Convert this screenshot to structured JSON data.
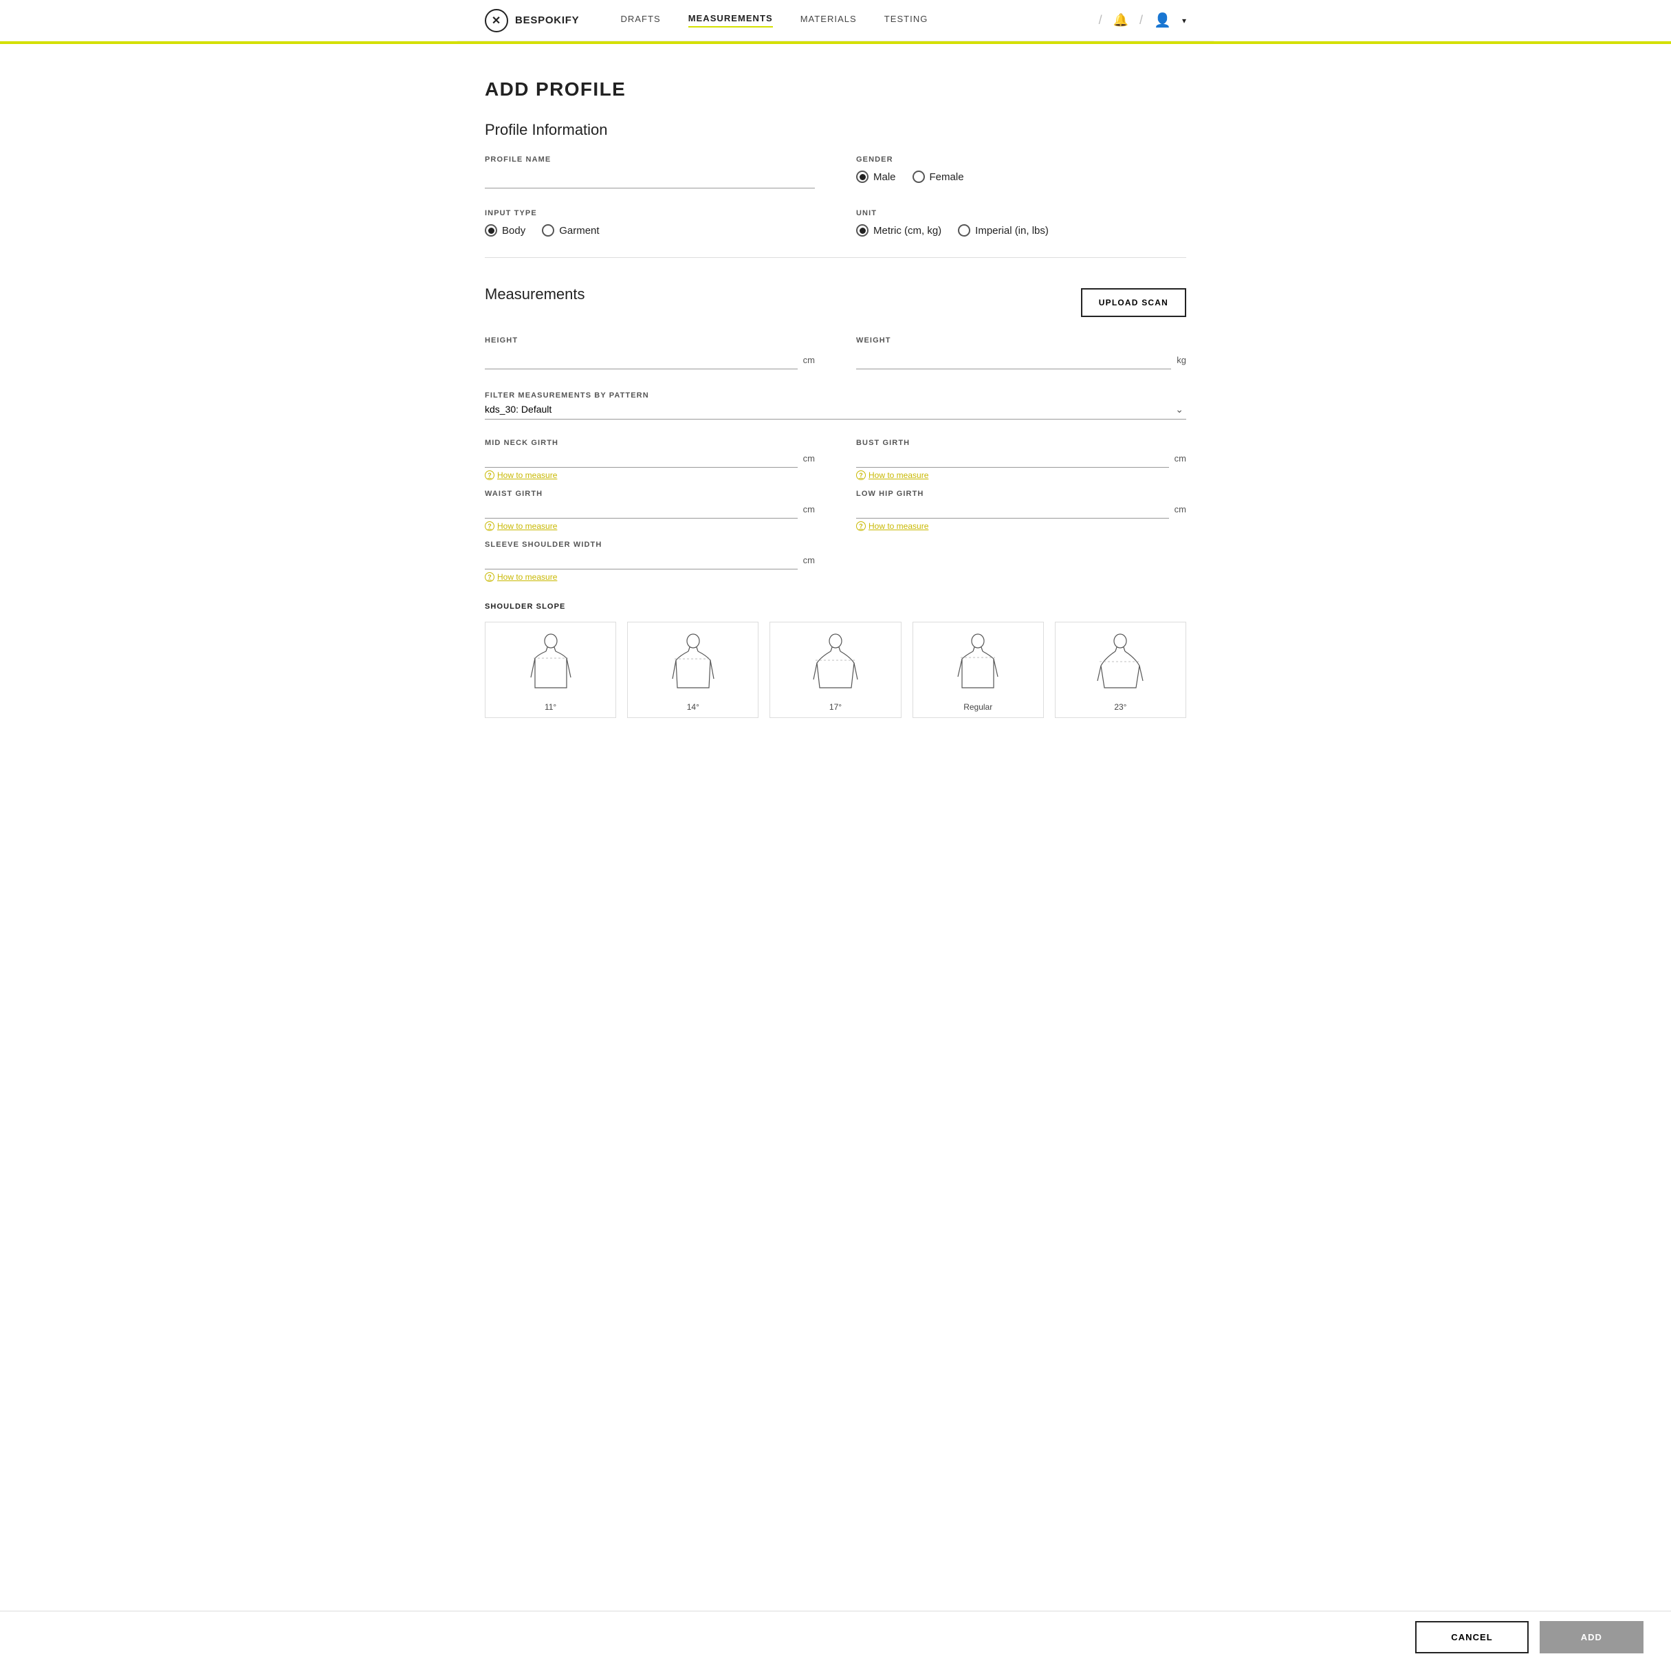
{
  "nav": {
    "logo_text": "BESPOKIFY",
    "links": [
      {
        "id": "drafts",
        "label": "DRAFTS",
        "active": false
      },
      {
        "id": "measurements",
        "label": "MEASUREMENTS",
        "active": true
      },
      {
        "id": "materials",
        "label": "MATERIALS",
        "active": false
      },
      {
        "id": "testing",
        "label": "TESTING",
        "active": false
      }
    ]
  },
  "page": {
    "title": "ADD PROFILE",
    "profile_section_title": "Profile Information",
    "profile_name_label": "PROFILE NAME",
    "profile_name_placeholder": "",
    "gender_label": "GENDER",
    "gender_options": [
      {
        "id": "male",
        "label": "Male",
        "checked": true
      },
      {
        "id": "female",
        "label": "Female",
        "checked": false
      }
    ],
    "input_type_label": "INPUT TYPE",
    "input_type_options": [
      {
        "id": "body",
        "label": "Body",
        "checked": true
      },
      {
        "id": "garment",
        "label": "Garment",
        "checked": false
      }
    ],
    "unit_label": "UNIT",
    "unit_options": [
      {
        "id": "metric",
        "label": "Metric (cm, kg)",
        "checked": true
      },
      {
        "id": "imperial",
        "label": "Imperial (in, lbs)",
        "checked": false
      }
    ],
    "measurements_title": "Measurements",
    "upload_scan_label": "UPLOAD SCAN",
    "height_label": "HEIGHT",
    "height_unit": "cm",
    "weight_label": "WEIGHT",
    "weight_unit": "kg",
    "filter_label": "FILTER MEASUREMENTS BY PATTERN",
    "filter_value": "kds_30: Default",
    "fields": [
      {
        "id": "mid_neck_girth",
        "label": "MID NECK GIRTH",
        "unit": "cm",
        "how_to": "How to measure"
      },
      {
        "id": "bust_girth",
        "label": "BUST GIRTH",
        "unit": "cm",
        "how_to": "How to measure"
      },
      {
        "id": "waist_girth",
        "label": "WAIST GIRTH",
        "unit": "cm",
        "how_to": "How to measure"
      },
      {
        "id": "low_hip_girth",
        "label": "LOW HIP GIRTH",
        "unit": "cm",
        "how_to": "How to measure"
      },
      {
        "id": "sleeve_shoulder_width",
        "label": "SLEEVE SHOULDER WIDTH",
        "unit": "cm",
        "how_to": "How to measure"
      }
    ],
    "shoulder_slope_label": "SHOULDER SLOPE",
    "shoulder_options": [
      {
        "id": "11",
        "label": "11°"
      },
      {
        "id": "14",
        "label": "14°"
      },
      {
        "id": "17",
        "label": "17°"
      },
      {
        "id": "regular",
        "label": "Regular"
      },
      {
        "id": "23",
        "label": "23°"
      }
    ]
  },
  "footer": {
    "cancel_label": "CANCEL",
    "add_label": "ADD"
  }
}
